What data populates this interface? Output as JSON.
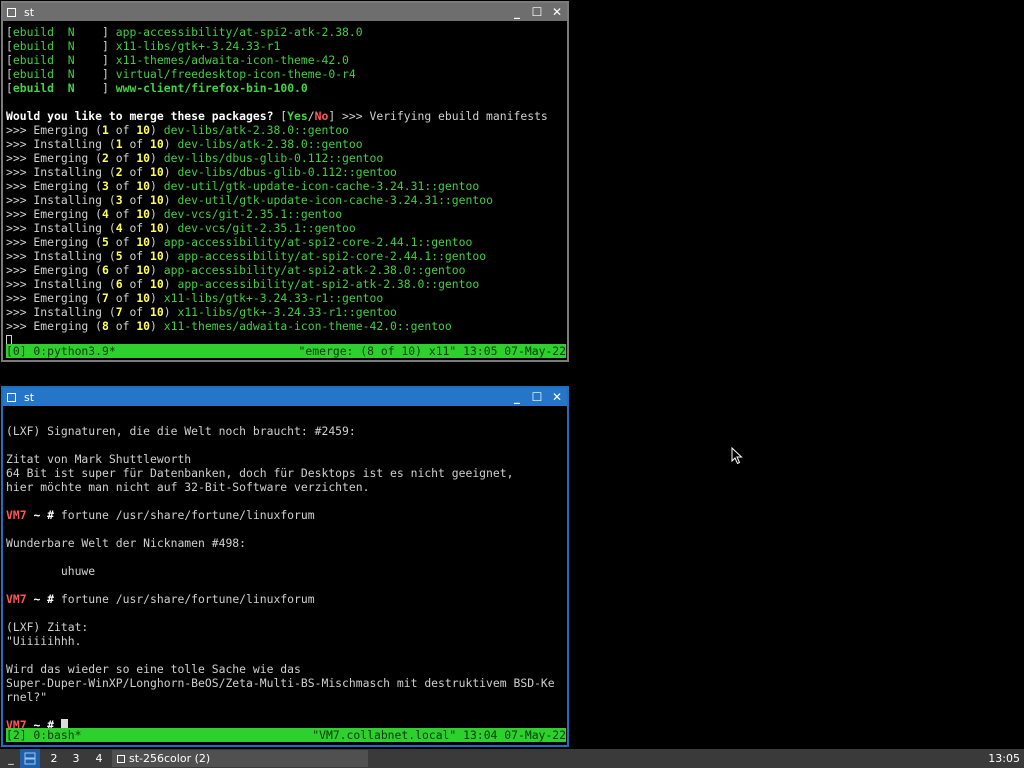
{
  "window1": {
    "title": "st",
    "min_glyph": "_",
    "max_glyph": "☐",
    "close_glyph": "✕",
    "ebuild_lines": [
      {
        "tag": "ebuild",
        "flag": "N",
        "pkg": "app-accessibility/at-spi2-atk-2.38.0",
        "bold": false
      },
      {
        "tag": "ebuild",
        "flag": "N",
        "pkg": "x11-libs/gtk+-3.24.33-r1",
        "bold": false
      },
      {
        "tag": "ebuild",
        "flag": "N",
        "pkg": "x11-themes/adwaita-icon-theme-42.0",
        "bold": false
      },
      {
        "tag": "ebuild",
        "flag": "N",
        "pkg": "virtual/freedesktop-icon-theme-0-r4",
        "bold": false
      },
      {
        "tag": "ebuild",
        "flag": "N",
        "pkg": "www-client/firefox-bin-100.0",
        "bold": true
      }
    ],
    "prompt_question": "Would you like to merge these packages?",
    "prompt_yes": "Yes",
    "prompt_no": "No",
    "prompt_tail": ">>> Verifying ebuild manifests",
    "steps": [
      {
        "action": "Emerging",
        "n": "1",
        "total": "10",
        "pkg": "dev-libs/atk-2.38.0::gentoo"
      },
      {
        "action": "Installing",
        "n": "1",
        "total": "10",
        "pkg": "dev-libs/atk-2.38.0::gentoo"
      },
      {
        "action": "Emerging",
        "n": "2",
        "total": "10",
        "pkg": "dev-libs/dbus-glib-0.112::gentoo"
      },
      {
        "action": "Installing",
        "n": "2",
        "total": "10",
        "pkg": "dev-libs/dbus-glib-0.112::gentoo"
      },
      {
        "action": "Emerging",
        "n": "3",
        "total": "10",
        "pkg": "dev-util/gtk-update-icon-cache-3.24.31::gentoo"
      },
      {
        "action": "Installing",
        "n": "3",
        "total": "10",
        "pkg": "dev-util/gtk-update-icon-cache-3.24.31::gentoo"
      },
      {
        "action": "Emerging",
        "n": "4",
        "total": "10",
        "pkg": "dev-vcs/git-2.35.1::gentoo"
      },
      {
        "action": "Installing",
        "n": "4",
        "total": "10",
        "pkg": "dev-vcs/git-2.35.1::gentoo"
      },
      {
        "action": "Emerging",
        "n": "5",
        "total": "10",
        "pkg": "app-accessibility/at-spi2-core-2.44.1::gentoo"
      },
      {
        "action": "Installing",
        "n": "5",
        "total": "10",
        "pkg": "app-accessibility/at-spi2-core-2.44.1::gentoo"
      },
      {
        "action": "Emerging",
        "n": "6",
        "total": "10",
        "pkg": "app-accessibility/at-spi2-atk-2.38.0::gentoo"
      },
      {
        "action": "Installing",
        "n": "6",
        "total": "10",
        "pkg": "app-accessibility/at-spi2-atk-2.38.0::gentoo"
      },
      {
        "action": "Emerging",
        "n": "7",
        "total": "10",
        "pkg": "x11-libs/gtk+-3.24.33-r1::gentoo"
      },
      {
        "action": "Installing",
        "n": "7",
        "total": "10",
        "pkg": "x11-libs/gtk+-3.24.33-r1::gentoo"
      },
      {
        "action": "Emerging",
        "n": "8",
        "total": "10",
        "pkg": "x11-themes/adwaita-icon-theme-42.0::gentoo"
      }
    ],
    "status_left": "[0] 0:python3.9*",
    "status_right": "\"emerge: (8 of 10) x11\" 13:05 07-May-22"
  },
  "window2": {
    "title": "st",
    "min_glyph": "_",
    "max_glyph": "☐",
    "close_glyph": "✕",
    "lines": [
      {
        "kind": "blank"
      },
      {
        "kind": "text",
        "text": "(LXF) Signaturen, die die Welt noch braucht: #2459:"
      },
      {
        "kind": "blank"
      },
      {
        "kind": "text",
        "text": "Zitat von Mark Shuttleworth"
      },
      {
        "kind": "text",
        "text": "64 Bit ist super für Datenbanken, doch für Desktops ist es nicht geeignet,"
      },
      {
        "kind": "text",
        "text": "hier möchte man nicht auf 32-Bit-Software verzichten."
      },
      {
        "kind": "blank"
      },
      {
        "kind": "prompt",
        "host": "VM7",
        "path": "~",
        "sym": "#",
        "cmd": "fortune /usr/share/fortune/linuxforum"
      },
      {
        "kind": "blank"
      },
      {
        "kind": "text",
        "text": "Wunderbare Welt der Nicknamen #498:"
      },
      {
        "kind": "blank"
      },
      {
        "kind": "text",
        "text": "        uhuwe"
      },
      {
        "kind": "blank"
      },
      {
        "kind": "prompt",
        "host": "VM7",
        "path": "~",
        "sym": "#",
        "cmd": "fortune /usr/share/fortune/linuxforum"
      },
      {
        "kind": "blank"
      },
      {
        "kind": "text",
        "text": "(LXF) Zitat:"
      },
      {
        "kind": "text",
        "text": "\"Uiiiiihhh."
      },
      {
        "kind": "blank"
      },
      {
        "kind": "text",
        "text": "Wird das wieder so eine tolle Sache wie das"
      },
      {
        "kind": "text",
        "text": "Super-Duper-WinXP/Longhorn-BeOS/Zeta-Multi-BS-Mischmasch mit destruktivem BSD-Ke"
      },
      {
        "kind": "text",
        "text": "rnel?\""
      },
      {
        "kind": "blank"
      },
      {
        "kind": "prompt",
        "host": "VM7",
        "path": "~",
        "sym": "#",
        "cmd": ""
      }
    ],
    "status_left": "[2] 0:bash*",
    "status_right": "\"VM7.collabnet.local\" 13:04 07-May-22"
  },
  "taskbar": {
    "show_desktop": "_",
    "desktops": [
      "1",
      "2",
      "3",
      "4"
    ],
    "active_desktop": "1",
    "task_label": "st-256color (2)",
    "clock": "13:05"
  }
}
